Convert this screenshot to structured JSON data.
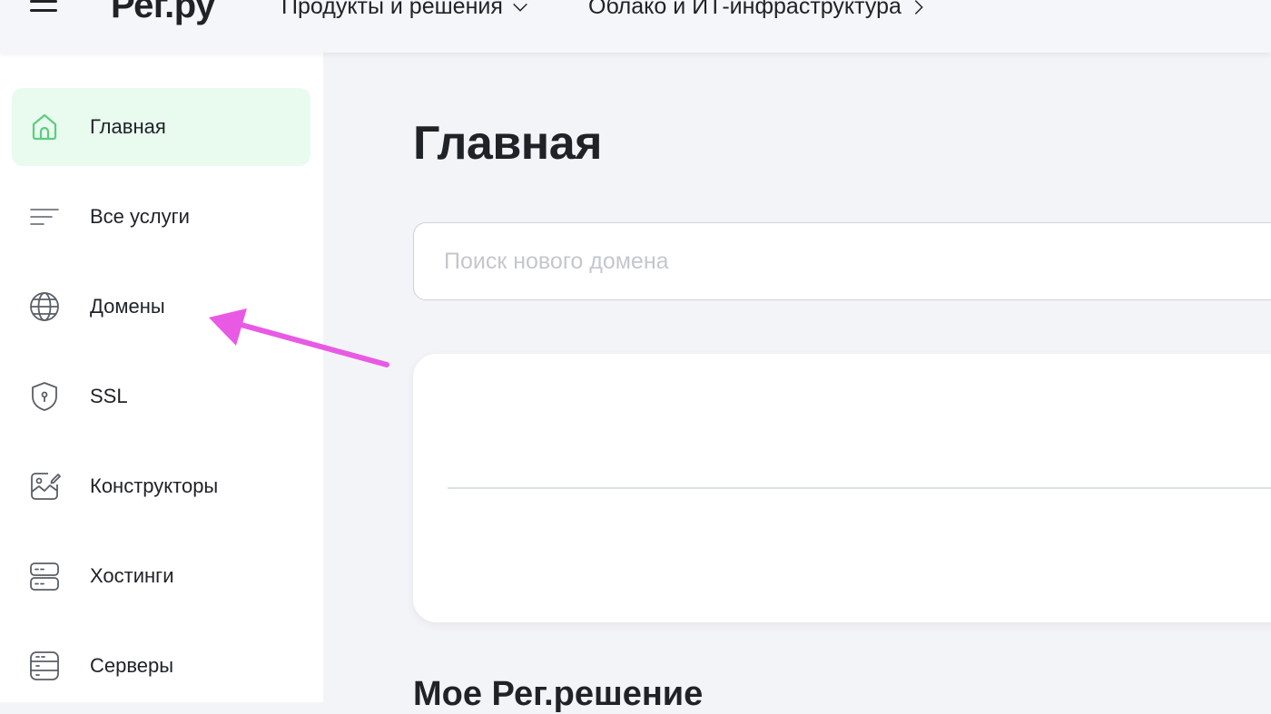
{
  "header": {
    "logo": "Рег.ру",
    "nav": [
      {
        "label": "Продукты и решения",
        "icon": "chevron-down-icon"
      },
      {
        "label": "Облако и ИТ-инфраструктура",
        "icon": "chevron-right-icon"
      }
    ]
  },
  "sidebar": {
    "items": [
      {
        "label": "Главная",
        "icon": "home-icon",
        "active": true
      },
      {
        "label": "Все услуги",
        "icon": "list-icon"
      },
      {
        "label": "Домены",
        "icon": "globe-icon"
      },
      {
        "label": "SSL",
        "icon": "shield-icon"
      },
      {
        "label": "Конструкторы",
        "icon": "site-builder-icon"
      },
      {
        "label": "Хостинги",
        "icon": "hosting-icon"
      },
      {
        "label": "Серверы",
        "icon": "server-icon"
      }
    ]
  },
  "main": {
    "title": "Главная",
    "search": {
      "placeholder": "Поиск нового домена",
      "value": ""
    },
    "section_title": "Мое Рег.решение"
  },
  "colors": {
    "accent": "#5ccd7e",
    "active_bg": "#e9faef",
    "annotation_arrow": "#e85ae4",
    "page_bg": "#f3f4f8"
  }
}
